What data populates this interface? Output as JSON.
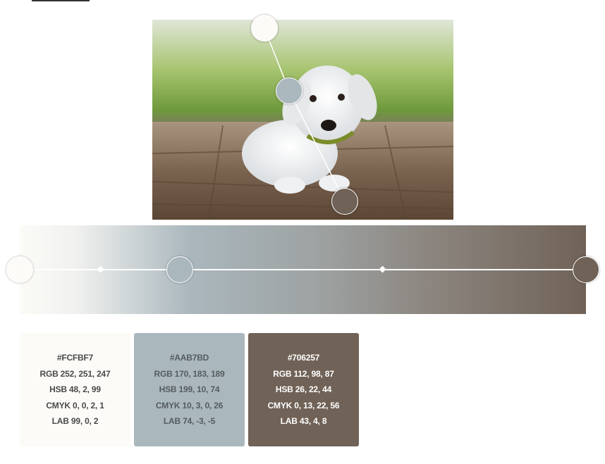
{
  "photo": {
    "alt_icon": "puppy-photo"
  },
  "colors": {
    "light": "#fcfbf7",
    "mid": "#aab7bd",
    "dark": "#706257"
  },
  "swatches": [
    {
      "hex": "#FCFBF7",
      "rgb": "RGB 252, 251, 247",
      "hsb": "HSB 48, 2, 99",
      "cmyk": "CMYK 0, 0, 2, 1",
      "lab": "LAB 99, 0, 2"
    },
    {
      "hex": "#AAB7BD",
      "rgb": "RGB 170, 183, 189",
      "hsb": "HSB 199, 10, 74",
      "cmyk": "CMYK 10, 3, 0, 26",
      "lab": "LAB 74, -3, -5"
    },
    {
      "hex": "#706257",
      "rgb": "RGB 112, 98, 87",
      "hsb": "HSB 26, 22, 44",
      "cmyk": "CMYK 0, 13, 22, 56",
      "lab": "LAB 43, 4, 8"
    }
  ]
}
